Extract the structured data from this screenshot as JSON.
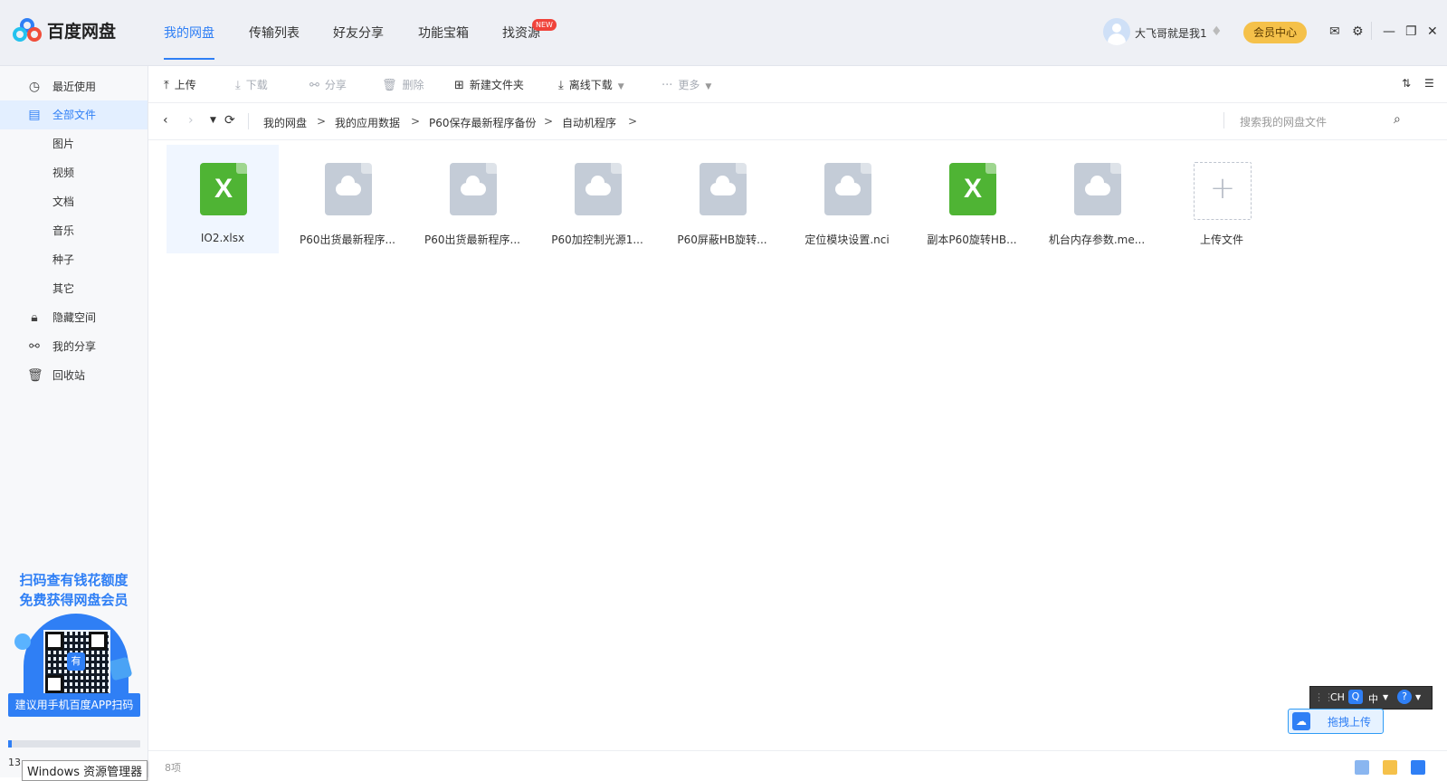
{
  "app": {
    "title": "百度网盘",
    "nav": [
      {
        "label": "我的网盘",
        "active": true
      },
      {
        "label": "传输列表",
        "active": false
      },
      {
        "label": "好友分享",
        "active": false
      },
      {
        "label": "功能宝箱",
        "active": false
      },
      {
        "label": "找资源",
        "active": false
      }
    ],
    "new_badge": "NEW",
    "user": {
      "name": "大飞哥就是我1"
    },
    "vip_label": "会员中心",
    "colors": {
      "accent": "#2f7ff5",
      "vip": "#f5c14a",
      "excel": "#4fb434"
    }
  },
  "sidebar": {
    "items": [
      {
        "label": "最近使用",
        "icon": "clock-icon"
      },
      {
        "label": "全部文件",
        "icon": "document-icon",
        "active": true
      },
      {
        "label": "隐藏空间",
        "icon": "lock-icon"
      },
      {
        "label": "我的分享",
        "icon": "share-icon"
      },
      {
        "label": "回收站",
        "icon": "trash-icon"
      }
    ],
    "sub_items": [
      "图片",
      "视频",
      "文档",
      "音乐",
      "种子",
      "其它"
    ],
    "promo": {
      "line1": "扫码查有钱花额度",
      "line2": "免费获得网盘会员",
      "qr_label": "有",
      "button": "建议用手机百度APP扫码"
    },
    "storage": {
      "text": "13",
      "progress": 0.03
    },
    "tooltip": "Windows 资源管理器"
  },
  "toolbar": {
    "upload": "上传",
    "download": "下载",
    "share": "分享",
    "delete": "删除",
    "new_folder": "新建文件夹",
    "offline_download": "离线下载",
    "more": "更多"
  },
  "breadcrumb": {
    "items": [
      "我的网盘",
      "我的应用数据",
      "P60保存最新程序备份",
      "自动机程序"
    ],
    "separator": ">"
  },
  "search": {
    "placeholder": "搜索我的网盘文件"
  },
  "files": [
    {
      "name": "IO2.xlsx",
      "type": "excel",
      "selected": true
    },
    {
      "name": "P60出货最新程序...",
      "type": "cloud"
    },
    {
      "name": "P60出货最新程序...",
      "type": "cloud"
    },
    {
      "name": "P60加控制光源1...",
      "type": "cloud"
    },
    {
      "name": "P60屏蔽HB旋转...",
      "type": "cloud"
    },
    {
      "name": "定位模块设置.nci",
      "type": "cloud"
    },
    {
      "name": "副本P60旋转HB...",
      "type": "excel"
    },
    {
      "name": "机台内存参数.me...",
      "type": "cloud"
    }
  ],
  "upload_tile": {
    "label": "上传文件"
  },
  "status": {
    "count": "8项"
  },
  "ime": {
    "lang": "CH",
    "mode": "中"
  },
  "drag_upload": "拖拽上传"
}
